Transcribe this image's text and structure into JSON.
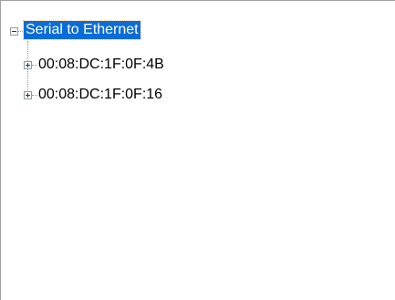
{
  "tree": {
    "root": {
      "label": "Serial to Ethernet",
      "expanded": true,
      "selected": true,
      "expander_icon": "minus-icon"
    },
    "children": [
      {
        "label": "00:08:DC:1F:0F:4B",
        "expanded": false,
        "expander_icon": "plus-icon"
      },
      {
        "label": "00:08:DC:1F:0F:16",
        "expanded": false,
        "expander_icon": "plus-icon"
      }
    ]
  },
  "colors": {
    "selection_bg": "#0a6cd6",
    "selection_text": "#ffffff",
    "border": "#a0a0a0",
    "tree_lines": "#9a9a9a"
  }
}
